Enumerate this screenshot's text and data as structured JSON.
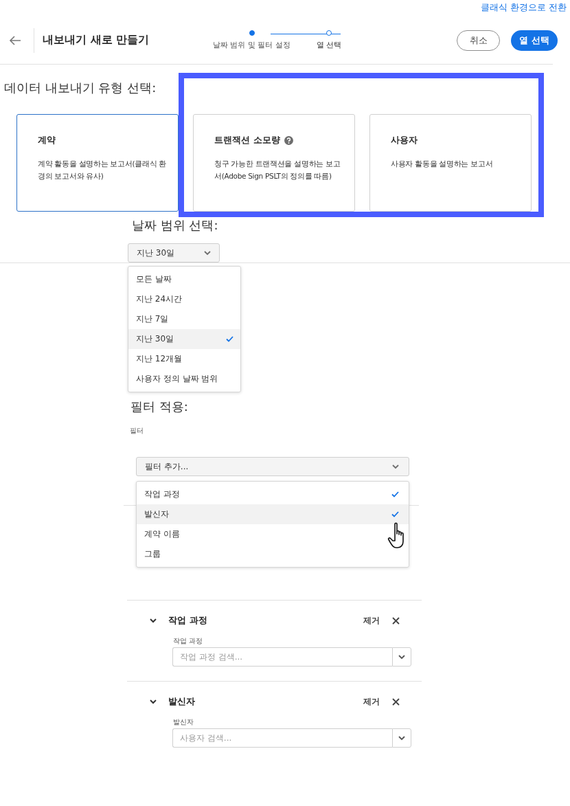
{
  "top_link": "클래식 환경으로 전환",
  "header": {
    "title": "내보내기 새로 만들기",
    "steps": [
      {
        "label": "날짜 범위 및 필터 설정",
        "active": true
      },
      {
        "label": "열 선택",
        "active": false
      }
    ],
    "buttons": [
      {
        "label": "취소",
        "kind": "secondary"
      },
      {
        "label": "열 선택",
        "kind": "primary"
      }
    ]
  },
  "export_type": {
    "heading": "데이터 내보내기 유형 선택:",
    "cards": [
      {
        "title": "계약",
        "description": "계약 활동을 설명하는 보고서(클래식 환경의 보고서와 유사)",
        "selected": true,
        "help": false
      },
      {
        "title": "트랜잭션 소모량",
        "description": "청구 가능한 트랜잭션을 설명하는 보고서(Adobe Sign PSLT의 정의를 따름)",
        "selected": false,
        "help": true
      },
      {
        "title": "사용자",
        "description": "사용자 활동을 설명하는 보고서",
        "selected": false,
        "help": false
      }
    ]
  },
  "date_range": {
    "heading": "날짜 범위 선택:",
    "value": "지난 30일",
    "options": [
      {
        "label": "모든 날짜",
        "selected": false
      },
      {
        "label": "지난 24시간",
        "selected": false
      },
      {
        "label": "지난 7일",
        "selected": false
      },
      {
        "label": "지난 30일",
        "selected": true
      },
      {
        "label": "지난 12개월",
        "selected": false
      },
      {
        "label": "사용자 정의 날짜 범위",
        "selected": false
      }
    ]
  },
  "filters": {
    "heading": "필터 적용:",
    "label": "필터",
    "button_label": "필터 추가...",
    "options": [
      {
        "label": "작업 과정",
        "checked": true,
        "hovered": false
      },
      {
        "label": "발신자",
        "checked": true,
        "hovered": true
      },
      {
        "label": "계약 이름",
        "checked": false,
        "hovered": false
      },
      {
        "label": "그룹",
        "checked": false,
        "hovered": false
      }
    ],
    "sections": [
      {
        "title": "작업 과정",
        "remove": "제거",
        "field_label": "작업 과정",
        "placeholder": "작업 과정 검색...",
        "expanded": true
      },
      {
        "title": "발신자",
        "remove": "제거",
        "field_label": "발신자",
        "placeholder": "사용자 검색...",
        "expanded": true
      }
    ]
  }
}
